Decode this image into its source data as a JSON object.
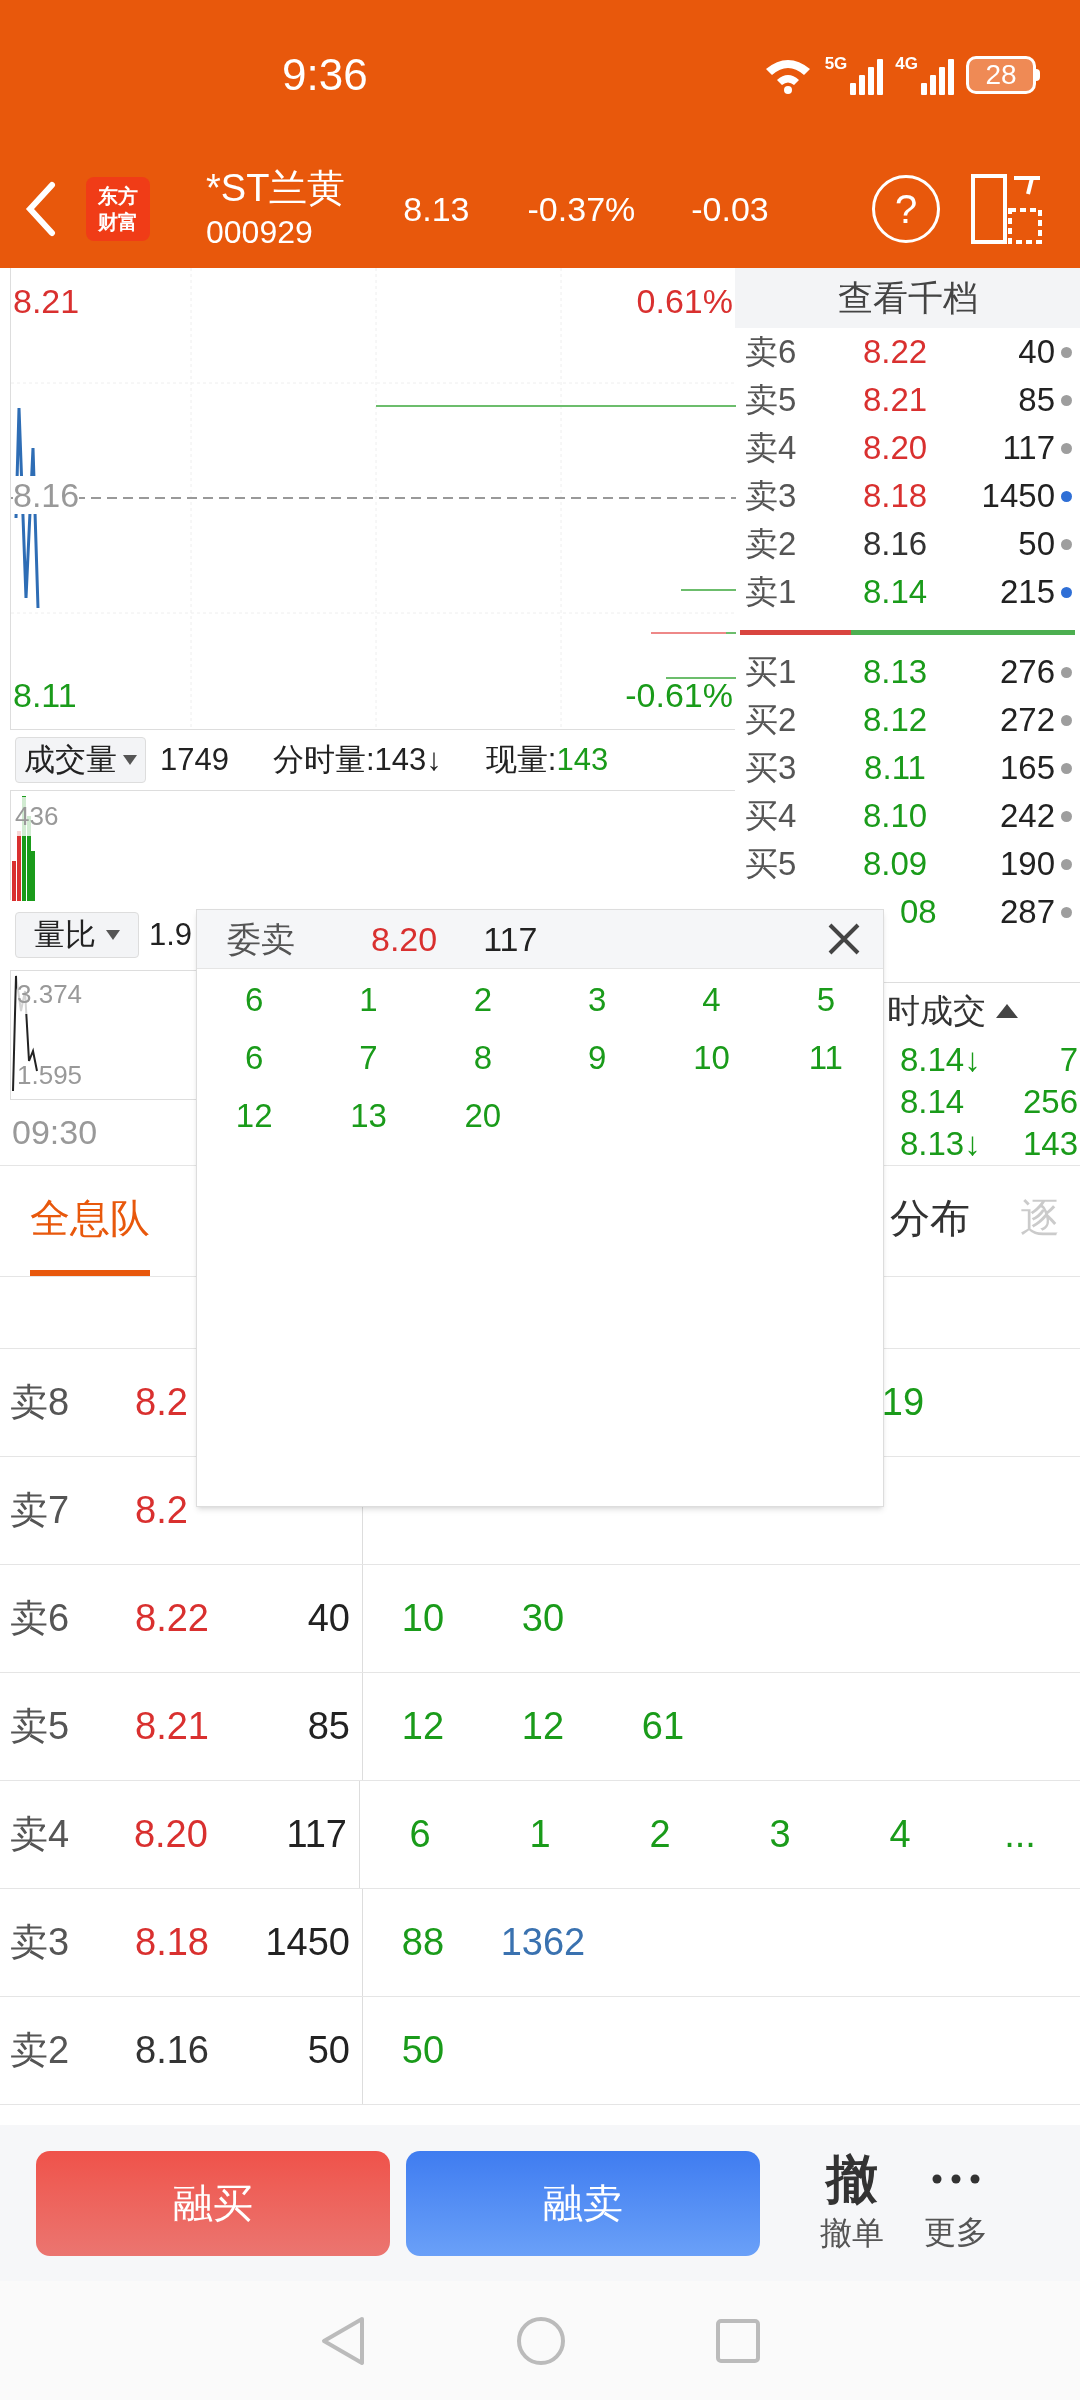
{
  "status_bar": {
    "time": "9:36",
    "net_5g": "5G",
    "net_4g": "4G",
    "battery": "28"
  },
  "header": {
    "logo": [
      "东方",
      "财富"
    ],
    "name": "*ST兰黄",
    "code": "000929",
    "price": "8.13",
    "change_pct": "-0.37%",
    "change": "-0.03",
    "help": "?"
  },
  "chart": {
    "high": "8.21",
    "mid": "8.16",
    "low": "8.11",
    "high_pct": "0.61%",
    "low_pct": "-0.61%"
  },
  "volume_bar": {
    "selector": "成交量",
    "total": "1749",
    "tick_volume": "分时量:143↓",
    "current_label": "现量:",
    "current_value": "143",
    "max": "436"
  },
  "ratio_bar": {
    "selector": "量比",
    "value": "1.9",
    "max": "3.374",
    "min": "1.595"
  },
  "time_axis": "09:30",
  "order_book": {
    "title": "查看千档",
    "asks": [
      {
        "label": "卖6",
        "price": "8.22",
        "color": "#d9302f",
        "volume": "40",
        "highlighted": false
      },
      {
        "label": "卖5",
        "price": "8.21",
        "color": "#d9302f",
        "volume": "85",
        "highlighted": false
      },
      {
        "label": "卖4",
        "price": "8.20",
        "color": "#d9302f",
        "volume": "117",
        "highlighted": false
      },
      {
        "label": "卖3",
        "price": "8.18",
        "color": "#d9302f",
        "volume": "1450",
        "highlighted": true
      },
      {
        "label": "卖2",
        "price": "8.16",
        "color": "#333333",
        "volume": "50",
        "highlighted": false
      },
      {
        "label": "卖1",
        "price": "8.14",
        "color": "#1a9b1a",
        "volume": "215",
        "highlighted": true
      }
    ],
    "bids": [
      {
        "label": "买1",
        "price": "8.13",
        "color": "#1a9b1a",
        "volume": "276",
        "highlighted": false
      },
      {
        "label": "买2",
        "price": "8.12",
        "color": "#1a9b1a",
        "volume": "272",
        "highlighted": false
      },
      {
        "label": "买3",
        "price": "8.11",
        "color": "#1a9b1a",
        "volume": "165",
        "highlighted": false
      },
      {
        "label": "买4",
        "price": "8.10",
        "color": "#1a9b1a",
        "volume": "242",
        "highlighted": false
      },
      {
        "label": "买5",
        "price": "8.09",
        "color": "#1a9b1a",
        "volume": "190",
        "highlighted": false
      }
    ],
    "partial_bid": {
      "price": "08",
      "color": "#1a9b1a",
      "volume": "287",
      "highlighted": false
    }
  },
  "trades": {
    "title": "时成交",
    "rows": [
      {
        "price": "8.14↓",
        "volume": "7"
      },
      {
        "price": "8.14",
        "volume": "256"
      },
      {
        "price": "8.13↓",
        "volume": "143"
      }
    ]
  },
  "tabs": [
    {
      "label": "全息队",
      "selected": true,
      "faded": false
    },
    {
      "label": "分布",
      "selected": false,
      "faded": false
    },
    {
      "label": "逐",
      "selected": false,
      "faded": true
    }
  ],
  "queue_table": {
    "rows": [
      {
        "label": "卖8",
        "price": "8.2",
        "color": "#d9302f",
        "kind": "partly_covered",
        "queue": [
          {
            "text": "19",
            "color": "#1a9b1a"
          }
        ]
      },
      {
        "label": "卖7",
        "price": "8.2",
        "color": "#d9302f",
        "kind": "full"
      },
      {
        "label": "卖6",
        "price": "8.22",
        "color": "#d9302f",
        "kind": "full",
        "volume": "40",
        "queue": [
          {
            "text": "10",
            "color": "#1a9b1a"
          },
          {
            "text": "30",
            "color": "#1a9b1a"
          }
        ]
      },
      {
        "label": "卖5",
        "price": "8.21",
        "color": "#d9302f",
        "kind": "full",
        "volume": "85",
        "queue": [
          {
            "text": "12",
            "color": "#1a9b1a"
          },
          {
            "text": "12",
            "color": "#1a9b1a"
          },
          {
            "text": "61",
            "color": "#1a9b1a"
          }
        ]
      },
      {
        "label": "卖4",
        "price": "8.20",
        "color": "#d9302f",
        "kind": "full",
        "volume": "117",
        "queue": [
          {
            "text": "6",
            "color": "#1a9b1a"
          },
          {
            "text": "1",
            "color": "#1a9b1a"
          },
          {
            "text": "2",
            "color": "#1a9b1a"
          },
          {
            "text": "3",
            "color": "#1a9b1a"
          },
          {
            "text": "4",
            "color": "#1a9b1a"
          },
          {
            "text": "...",
            "color": "#1a9b1a"
          }
        ]
      },
      {
        "label": "卖3",
        "price": "8.18",
        "color": "#d9302f",
        "kind": "full",
        "volume": "1450",
        "queue": [
          {
            "text": "88",
            "color": "#1a9b1a"
          },
          {
            "text": "1362",
            "color": "#3a72b0"
          }
        ]
      },
      {
        "label": "卖2",
        "price": "8.16",
        "color": "#333333",
        "kind": "full",
        "volume": "50",
        "queue": [
          {
            "text": "50",
            "color": "#1a9b1a"
          }
        ]
      }
    ]
  },
  "popup": {
    "title": "委卖",
    "price": "8.20",
    "volume": "117",
    "orders": [
      "6",
      "1",
      "2",
      "3",
      "4",
      "5",
      "6",
      "7",
      "8",
      "9",
      "10",
      "11",
      "12",
      "13",
      "20"
    ]
  },
  "actions": {
    "buttons": [
      {
        "label": "融买",
        "kind": "buy"
      },
      {
        "label": "融卖",
        "kind": "sell"
      }
    ],
    "cancel": {
      "glyph": "撤",
      "label": "撤单"
    },
    "more": {
      "label": "更多"
    }
  }
}
